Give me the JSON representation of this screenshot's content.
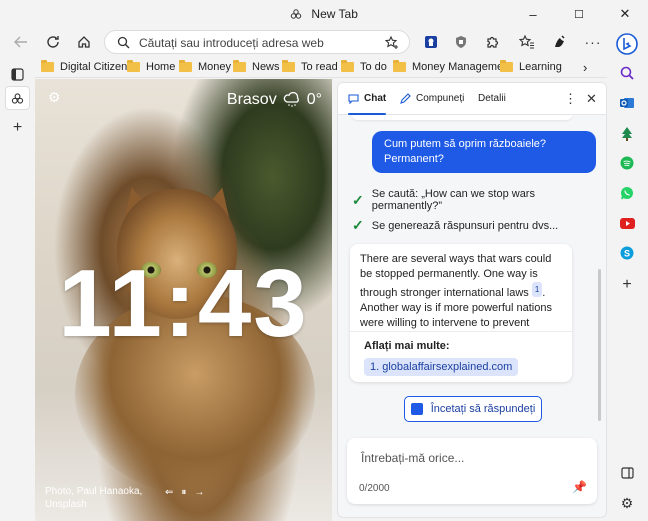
{
  "window": {
    "title": "New Tab",
    "minimize_glyph": "–",
    "maximize_glyph": "☐",
    "close_glyph": "✕"
  },
  "toolbar": {
    "address_placeholder": "Căutați sau introduceți adresa web"
  },
  "bookmarks": [
    {
      "label": "Digital Citizen"
    },
    {
      "label": "Home"
    },
    {
      "label": "Money"
    },
    {
      "label": "News"
    },
    {
      "label": "To read"
    },
    {
      "label": "To do"
    },
    {
      "label": "Money Management"
    },
    {
      "label": "Learning"
    }
  ],
  "newtab": {
    "city": "Brasov",
    "temperature": "0°",
    "time": "11:43",
    "photo_credit_line1": "Photo, Paul Hanaoka,",
    "photo_credit_line2": "Unsplash"
  },
  "copilot": {
    "tabs": [
      "Chat",
      "Compuneți",
      "Detalii"
    ],
    "user_message": "Cum putem să oprim războaiele? Permanent?",
    "status_search": "Se caută: „How can we stop wars permanently?”",
    "status_generating": "Se generează răspunsuri pentru dvs...",
    "answer_before_cite": "There are several ways that wars could be stopped permanently. One way is through stronger international laws",
    "cite_number": "1",
    "answer_after_cite": ". Another way is if more powerful nations were willing to intervene to prevent",
    "learn_more_label": "Aflați mai multe:",
    "source_link": "1. globalaffairsexplained.com",
    "stop_button": "Încetați să răspundeți",
    "input_placeholder": "Întrebați-mă orice...",
    "char_counter": "0/2000"
  },
  "colors": {
    "accent": "#1e5ae6",
    "success": "#1a8a3a"
  },
  "icons": {
    "sidebar_right": [
      "bing-copilot-icon",
      "search-icon",
      "outlook-icon",
      "tree-icon",
      "spotify-icon",
      "whatsapp-icon",
      "youtube-icon",
      "skype-icon",
      "add-icon",
      "split-screen-icon",
      "settings-icon"
    ]
  }
}
